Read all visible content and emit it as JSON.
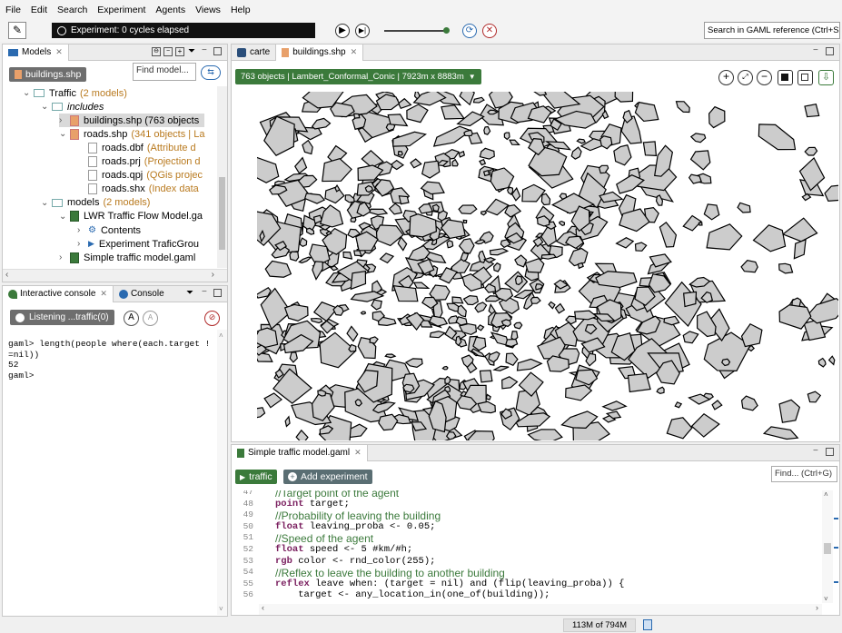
{
  "menu": [
    "File",
    "Edit",
    "Search",
    "Experiment",
    "Agents",
    "Views",
    "Help"
  ],
  "toolbar": {
    "status": "Experiment: 0 cycles elapsed",
    "search_placeholder": "Search in GAML reference (Ctrl+Shift+"
  },
  "models": {
    "tab_label": "Models",
    "breadcrumb": "buildings.shp",
    "find_placeholder": "Find model...",
    "tree": [
      {
        "label": "Traffic",
        "suffix": "(2 models)",
        "level": 1,
        "arrow": "down",
        "icon": "project"
      },
      {
        "label": "includes",
        "suffix": "",
        "level": 2,
        "arrow": "down",
        "icon": "folder",
        "italic": true
      },
      {
        "label": "buildings.shp (763 objects",
        "suffix": "",
        "level": 3,
        "arrow": "right",
        "icon": "shp",
        "selected": true
      },
      {
        "label": "roads.shp",
        "suffix": "(341 objects | La",
        "level": 3,
        "arrow": "down",
        "icon": "shp"
      },
      {
        "label": "roads.dbf",
        "suffix": "(Attribute d",
        "level": 4,
        "arrow": "",
        "icon": "file"
      },
      {
        "label": "roads.prj",
        "suffix": "(Projection d",
        "level": 4,
        "arrow": "",
        "icon": "file"
      },
      {
        "label": "roads.qpj",
        "suffix": "(QGis projec",
        "level": 4,
        "arrow": "",
        "icon": "file"
      },
      {
        "label": "roads.shx",
        "suffix": "(Index data",
        "level": 4,
        "arrow": "",
        "icon": "file"
      },
      {
        "label": "models",
        "suffix": "(2 models)",
        "level": 2,
        "arrow": "down",
        "icon": "folder"
      },
      {
        "label": "LWR Traffic Flow Model.ga",
        "suffix": "",
        "level": 3,
        "arrow": "down",
        "icon": "gaml"
      },
      {
        "label": "Contents",
        "suffix": "",
        "level": 4,
        "arrow": "right",
        "icon": "contents"
      },
      {
        "label": "Experiment TraficGrou",
        "suffix": "",
        "level": 4,
        "arrow": "right",
        "icon": "play"
      },
      {
        "label": "Simple traffic model.gaml",
        "suffix": "",
        "level": 3,
        "arrow": "right",
        "icon": "gaml"
      }
    ]
  },
  "console": {
    "tab_label": "Interactive console",
    "tab2_label": "Console",
    "listening": "Listening ...traffic(0)",
    "lines": [
      "gaml> length(people where(each.target !",
      "=nil))",
      "52",
      "gaml>"
    ]
  },
  "map": {
    "tab1": "carte",
    "tab2": "buildings.shp",
    "info": "763 objects | Lambert_Conformal_Conic | 7923m x 8883m"
  },
  "editor": {
    "tab_label": "Simple traffic model.gaml",
    "run_label": "traffic",
    "add_label": "Add experiment",
    "find_placeholder": "Find... (Ctrl+G)",
    "lines": [
      {
        "num": "47",
        "text": "//Target point of the agent",
        "type": "comment"
      },
      {
        "num": "48",
        "text": "point target;",
        "type": "code"
      },
      {
        "num": "49",
        "text": "//Probability of leaving the building",
        "type": "comment"
      },
      {
        "num": "50",
        "text": "float leaving_proba <- 0.05;",
        "type": "code"
      },
      {
        "num": "51",
        "text": "//Speed of the agent",
        "type": "comment"
      },
      {
        "num": "52",
        "text": "float speed <- 5 #km/#h;",
        "type": "code"
      },
      {
        "num": "53",
        "text": "rgb color <- rnd_color(255);",
        "type": "code"
      },
      {
        "num": "54",
        "text": "//Reflex to leave the building to another building",
        "type": "comment"
      },
      {
        "num": "55",
        "text": "reflex leave when: (target = nil) and (flip(leaving_proba)) {",
        "type": "code"
      },
      {
        "num": "56",
        "text": "    target <- any_location_in(one_of(building));",
        "type": "code"
      }
    ]
  },
  "statusbar": {
    "memory": "113M of 794M"
  },
  "colors": {
    "accent_green": "#3b7a3b",
    "building_fill": "#cccccc",
    "building_stroke": "#000000",
    "shp_orange": "#b97a1f"
  }
}
